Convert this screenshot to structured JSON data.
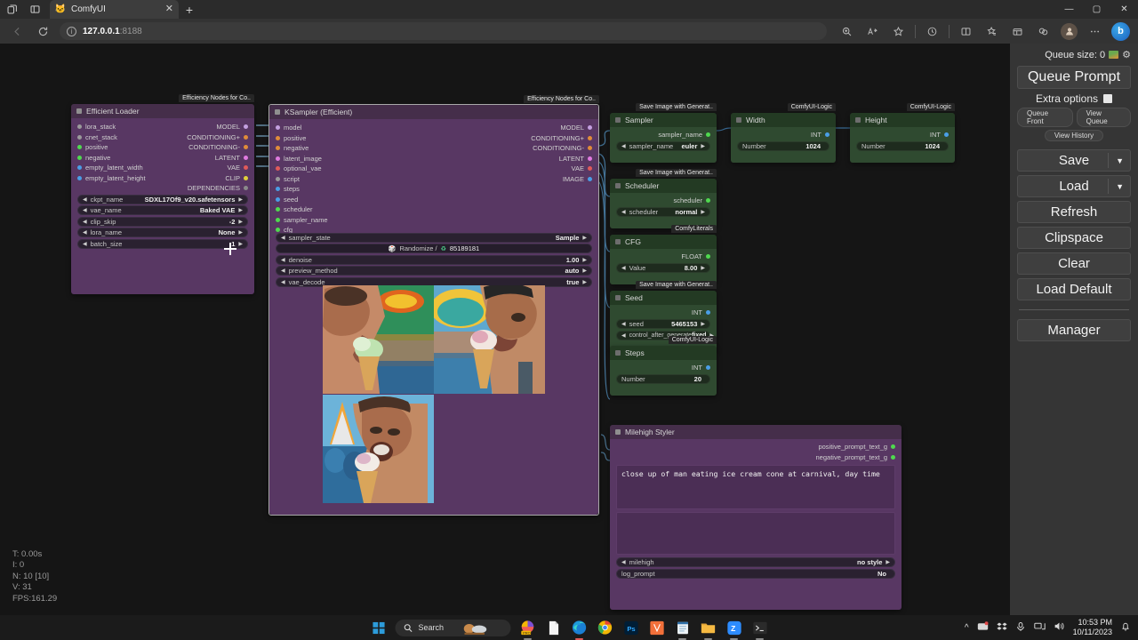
{
  "browser": {
    "tab_title": "ComfyUI",
    "tab_close": "✕",
    "new_tab": "+",
    "url_host": "127.0.0.1",
    "url_port": ":8188",
    "window_minimize": "—",
    "window_maximize": "▢",
    "window_close": "✕"
  },
  "canvas": {
    "stats": {
      "time": "T: 0.00s",
      "iterations": "I: 0",
      "nodes": "N: 10 [10]",
      "version": "V: 31",
      "fps": "FPS:161.29"
    }
  },
  "nodes": {
    "efficient_loader": {
      "badge": "Efficiency Nodes for Co..",
      "title": "Efficient Loader",
      "inputs": [
        {
          "label": "lora_stack",
          "color": "#9a9a9a"
        },
        {
          "label": "cnet_stack",
          "color": "#9a9a9a"
        },
        {
          "label": "positive",
          "color": "#4fd94f"
        },
        {
          "label": "negative",
          "color": "#4fd94f"
        },
        {
          "label": "empty_latent_width",
          "color": "#4a9ee6"
        },
        {
          "label": "empty_latent_height",
          "color": "#4a9ee6"
        }
      ],
      "outputs": [
        {
          "label": "MODEL",
          "color": "#c4a0e0"
        },
        {
          "label": "CONDITIONING+",
          "color": "#e08c3a"
        },
        {
          "label": "CONDITIONING-",
          "color": "#e08c3a"
        },
        {
          "label": "LATENT",
          "color": "#e07ae0"
        },
        {
          "label": "VAE",
          "color": "#e05a5a"
        },
        {
          "label": "CLIP",
          "color": "#e0d03a"
        },
        {
          "label": "DEPENDENCIES",
          "color": "#8a8a8a"
        }
      ],
      "widgets": [
        {
          "label": "ckpt_name",
          "value": "SDXL17Of9_v20.safetensors"
        },
        {
          "label": "vae_name",
          "value": "Baked VAE"
        },
        {
          "label": "clip_skip",
          "value": "-2"
        },
        {
          "label": "lora_name",
          "value": "None"
        },
        {
          "label": "batch_size",
          "value": "1"
        }
      ]
    },
    "ksampler": {
      "badge": "Efficiency Nodes for Co..",
      "title": "KSampler (Efficient)",
      "inputs": [
        {
          "label": "model",
          "color": "#c4a0e0"
        },
        {
          "label": "positive",
          "color": "#e08c3a"
        },
        {
          "label": "negative",
          "color": "#e08c3a"
        },
        {
          "label": "latent_image",
          "color": "#e07ae0"
        },
        {
          "label": "optional_vae",
          "color": "#e05a5a"
        },
        {
          "label": "script",
          "color": "#9a9a9a"
        },
        {
          "label": "steps",
          "color": "#4a9ee6"
        },
        {
          "label": "seed",
          "color": "#4a9ee6"
        },
        {
          "label": "scheduler",
          "color": "#4fd94f"
        },
        {
          "label": "sampler_name",
          "color": "#4fd94f"
        },
        {
          "label": "cfg",
          "color": "#4fd94f"
        }
      ],
      "outputs": [
        {
          "label": "MODEL",
          "color": "#c4a0e0"
        },
        {
          "label": "CONDITIONING+",
          "color": "#e08c3a"
        },
        {
          "label": "CONDITIONING-",
          "color": "#e08c3a"
        },
        {
          "label": "LATENT",
          "color": "#e07ae0"
        },
        {
          "label": "VAE",
          "color": "#e05a5a"
        },
        {
          "label": "IMAGE",
          "color": "#4a9ee6"
        }
      ],
      "widgets": [
        {
          "label": "sampler_state",
          "value": "Sample"
        },
        {
          "label": "denoise",
          "value": "1.00"
        },
        {
          "label": "preview_method",
          "value": "auto"
        },
        {
          "label": "vae_decode",
          "value": "true"
        }
      ],
      "seed_row": {
        "randomize_label": "Randomize /",
        "seed_value": "85189181"
      }
    },
    "sampler": {
      "badge": "Save Image with Generat..",
      "title": "Sampler",
      "output": {
        "label": "sampler_name",
        "color": "#4fd94f"
      },
      "widget": {
        "label": "sampler_name",
        "value": "euler"
      }
    },
    "scheduler": {
      "badge": "Save Image with Generat..",
      "title": "Scheduler",
      "output": {
        "label": "scheduler",
        "color": "#4fd94f"
      },
      "widget": {
        "label": "scheduler",
        "value": "normal"
      }
    },
    "cfg": {
      "badge": "ComfyLiterals",
      "title": "CFG",
      "output": {
        "label": "FLOAT",
        "color": "#4fd94f"
      },
      "widget": {
        "label": "Value",
        "value": "8.00"
      }
    },
    "seed": {
      "badge": "Save Image with Generat..",
      "title": "Seed",
      "output": {
        "label": "INT",
        "color": "#4a9ee6"
      },
      "widgets": [
        {
          "label": "seed",
          "value": "5465153"
        },
        {
          "label": "control_after_generate",
          "value": "fixed"
        }
      ]
    },
    "steps": {
      "badge": "ComfyUI-Logic",
      "title": "Steps",
      "output": {
        "label": "INT",
        "color": "#4a9ee6"
      },
      "widget": {
        "label": "Number",
        "value": "20"
      }
    },
    "width": {
      "badge": "ComfyUI-Logic",
      "title": "Width",
      "output": {
        "label": "INT",
        "color": "#4a9ee6"
      },
      "widget": {
        "label": "Number",
        "value": "1024"
      }
    },
    "height": {
      "badge": "ComfyUI-Logic",
      "title": "Height",
      "output": {
        "label": "INT",
        "color": "#4a9ee6"
      },
      "widget": {
        "label": "Number",
        "value": "1024"
      }
    },
    "milehigh_styler": {
      "title": "Milehigh Styler",
      "outputs": [
        {
          "label": "positive_prompt_text_g",
          "color": "#4fd94f"
        },
        {
          "label": "negative_prompt_text_g",
          "color": "#4fd94f"
        }
      ],
      "positive_prompt": "close up of man eating ice cream cone at carnival, day time",
      "negative_prompt": "",
      "widgets": [
        {
          "label": "milehigh",
          "value": "no style"
        },
        {
          "label": "log_prompt",
          "value": "No"
        }
      ]
    }
  },
  "panel": {
    "queue_size_label": "Queue size: 0",
    "queue_prompt": "Queue Prompt",
    "extra_options": "Extra options",
    "queue_front": "Queue Front",
    "view_queue": "View Queue",
    "view_history": "View History",
    "save": "Save",
    "load": "Load",
    "refresh": "Refresh",
    "clipspace": "Clipspace",
    "clear": "Clear",
    "load_default": "Load Default",
    "manager": "Manager",
    "caret": "▼"
  },
  "taskbar": {
    "search_label": "Search",
    "time": "10:53 PM",
    "date": "10/11/2023"
  }
}
